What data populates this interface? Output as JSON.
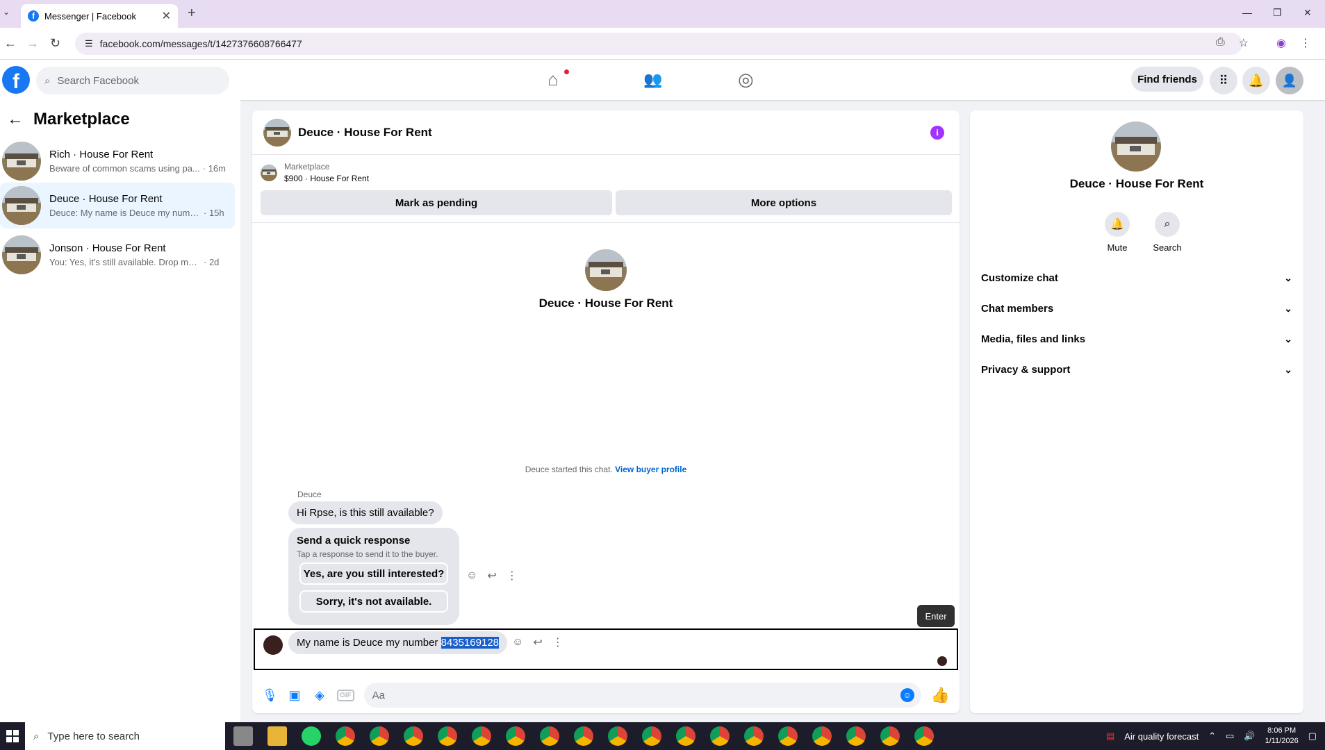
{
  "browser": {
    "tab_title": "Messenger | Facebook",
    "url": "facebook.com/messages/t/1427376608766477"
  },
  "header": {
    "search_placeholder": "Search Facebook",
    "find_friends": "Find friends"
  },
  "sidebar": {
    "title": "Marketplace",
    "conversations": [
      {
        "name": "Rich · House For Rent",
        "snippet": "Beware of common scams using pa...",
        "time": "· 16m"
      },
      {
        "name": "Deuce · House For Rent",
        "snippet": "Deuce: My name is Deuce my numb...",
        "time": "· 15h"
      },
      {
        "name": "Jonson · House For Rent",
        "snippet": "You: Yes, it's still available. Drop me y...",
        "time": "· 2d"
      }
    ]
  },
  "chat": {
    "title": "Deuce · House For Rent",
    "listing_source": "Marketplace",
    "listing_title": "$900 · House For Rent",
    "mark_pending": "Mark as pending",
    "more_options": "More options",
    "profile_name": "Deuce · House For Rent",
    "started_text": "Deuce started this chat.",
    "view_buyer": "View buyer profile",
    "sender": "Deuce",
    "message1": "Hi Rpse, is this still available?",
    "quick_title": "Send a quick response",
    "quick_sub": "Tap a response to send it to the buyer.",
    "quick_1": "Yes, are you still interested?",
    "quick_2": "Sorry, it's not available.",
    "tooltip": "Enter",
    "message2_prefix": "My name is Deuce my number ",
    "message2_number": "8435169128",
    "composer_placeholder": "Aa"
  },
  "details": {
    "name": "Deuce · House For Rent",
    "mute": "Mute",
    "search": "Search",
    "rows": [
      "Customize chat",
      "Chat members",
      "Media, files and links",
      "Privacy & support"
    ]
  },
  "taskbar": {
    "search_placeholder": "Type here to search",
    "weather": "Air quality forecast",
    "time": "8:06 PM",
    "date": "1/11/2026"
  }
}
